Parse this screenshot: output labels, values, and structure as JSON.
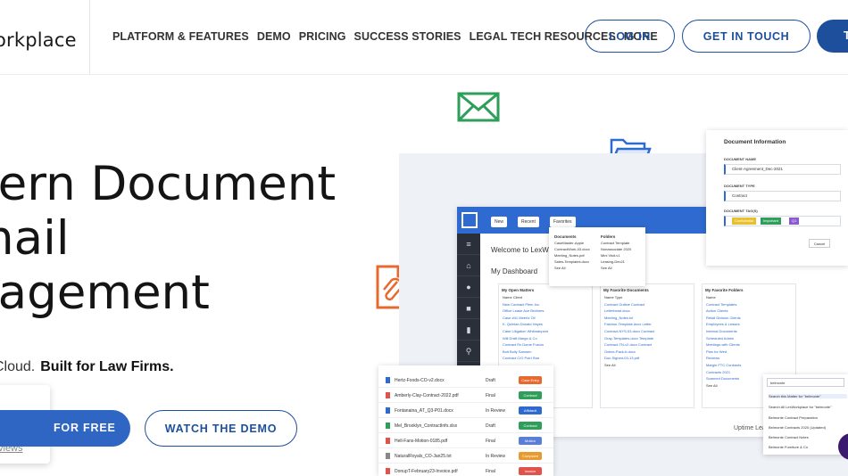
{
  "header": {
    "logo_text": "orkplace",
    "nav": [
      "PLATFORM & FEATURES",
      "DEMO",
      "PRICING",
      "SUCCESS STORIES",
      "LEGAL TECH RESOURCES",
      "MORE"
    ],
    "login_label": "LOG IN",
    "get_in_touch_label": "GET IN TOUCH",
    "cta_partial_label": "T"
  },
  "hero": {
    "title_lines": [
      "dern Document",
      "mail",
      "nagement"
    ],
    "tagline_prefix": "Cloud.",
    "tagline_bold": "Built for Law Firms.",
    "try_label": "FOR FREE",
    "demo_label": "WATCH THE DEMO",
    "stars": "★★",
    "reviews_label": "views"
  },
  "colors": {
    "brand_blue": "#1e4f9c",
    "accent_blue": "#2f66c4",
    "envelope_green": "#2e9e5a",
    "paperclip_orange": "#e8692e",
    "folder_blue": "#2f6ad0",
    "star_gold": "#f0a821"
  },
  "icons": [
    "envelope-icon",
    "folder-icon",
    "paperclip-document-icon"
  ],
  "mockup": {
    "btn_new": "New",
    "btn_recent": "Recent",
    "btn_favorites": "Favorites",
    "sidebar_icons": [
      "≡",
      "⌂",
      "●",
      "■",
      "▮",
      "⚲"
    ],
    "welcome": "Welcome to LexWo",
    "dashboard": "My Dashboard",
    "dropdown": {
      "documents_header": "Documents",
      "documents": [
        "CaseMaster-Apple",
        "ContractWork-03.docx",
        "Meeting_Notes.pdf",
        "Sales-Templates.docx"
      ],
      "folders_header": "Folders",
      "folders": [
        "Contract Template",
        "Nonassociate 2020",
        "Mini Visit-v1",
        "Leasing-Dec21"
      ],
      "see_all": "See All"
    },
    "cards": [
      {
        "title": "My Open Matters",
        "headers": "Name    Client",
        "rows": [
          "New Contract   Plem Inc.",
          "Office Lease   Ace Brothers",
          "Case #41   Meertz Oil",
          "K. Quinlan   Donald Hayes",
          "Case Litigation   Whitmanpent",
          "Will Draft   Margo & Co",
          "Contract Rx   Dome Fusion",
          "Bolt   Bolly Samsen",
          "Contract C/O   Poirt Star"
        ]
      },
      {
        "title": "My Favorite Documents",
        "headers": "Name    Type",
        "rows": [
          "Contract Outline   Contract",
          "Letterhead.docx",
          "Meeting_Notes.txt",
          "Fashion-Template.docx   Letter",
          "Contract-NYS-03.docx   Contract",
          "Gray-Templates.docx   Template",
          "Contract-TN-v2.docx   Contract",
          "Online-Pack-b.docx",
          "Doc-Signed-03-13.pdf"
        ],
        "see_all": "See All"
      },
      {
        "title": "My Favorite Folders",
        "headers": "Name",
        "rows": [
          "Contract Templates",
          "Action Clients",
          "Retail Division Clients",
          "Employees & Leases",
          "Internal Documents",
          "Scheduled Admin",
          "Meetings with Clients",
          "Plan for Wed",
          "Reviews",
          "Margin FTC Contracts",
          "Contracts 2021",
          "Scanned Documents"
        ],
        "see_all": "See All"
      }
    ],
    "uptime": "Uptime Lea"
  },
  "doc_info": {
    "title": "Document Information",
    "name_label": "DOCUMENT NAME",
    "name_value": "Client-Agreement_Dec-2021",
    "type_label": "DOCUMENT TYPE",
    "type_value": "Contract",
    "tags_label": "DOCUMENT TAG(S)",
    "tags": [
      "Confidential",
      "Important",
      "Q1"
    ],
    "cancel": "Cancel"
  },
  "files": [
    {
      "name": "Hertz-Foods-CO-v2.docx",
      "status": "Draft",
      "badge": "Case Entry",
      "badge_color": "#e8692e"
    },
    {
      "name": "Amberly-Clay-Contract-2022.pdf",
      "status": "Final",
      "badge": "Contract",
      "badge_color": "#2e9e5a"
    },
    {
      "name": "Fontanaina_AT_Q3-P01.docx",
      "status": "In Review",
      "badge": "Affidavit",
      "badge_color": "#2f6ad0"
    },
    {
      "name": "Mel_Brooklyn_ContractInfo.xlsx",
      "status": "Draft",
      "badge": "Contract",
      "badge_color": "#2e9e5a"
    },
    {
      "name": "Hell-Fans-Motion-0185.pdf",
      "status": "Final",
      "badge": "Motion",
      "badge_color": "#5a7fd8"
    },
    {
      "name": "NaturalRoyals_CO-Jan25.txt",
      "status": "In Review",
      "badge": "Complaint",
      "badge_color": "#e89a2e"
    },
    {
      "name": "DonupT-February23-Invoice.pdf",
      "status": "Final",
      "badge": "Invoice",
      "badge_color": "#e0524a"
    }
  ],
  "search": {
    "query": "belmonte",
    "results": [
      "Search this Matter for \"belmonte\"",
      "Search All LexWorkplace for \"belmonte\"",
      "Belmonte Contract Preparation",
      "Belmonte Contracts 2020 (Updated)",
      "Belmonte Contract Notes",
      "Belmonte Furniture & Co"
    ]
  }
}
